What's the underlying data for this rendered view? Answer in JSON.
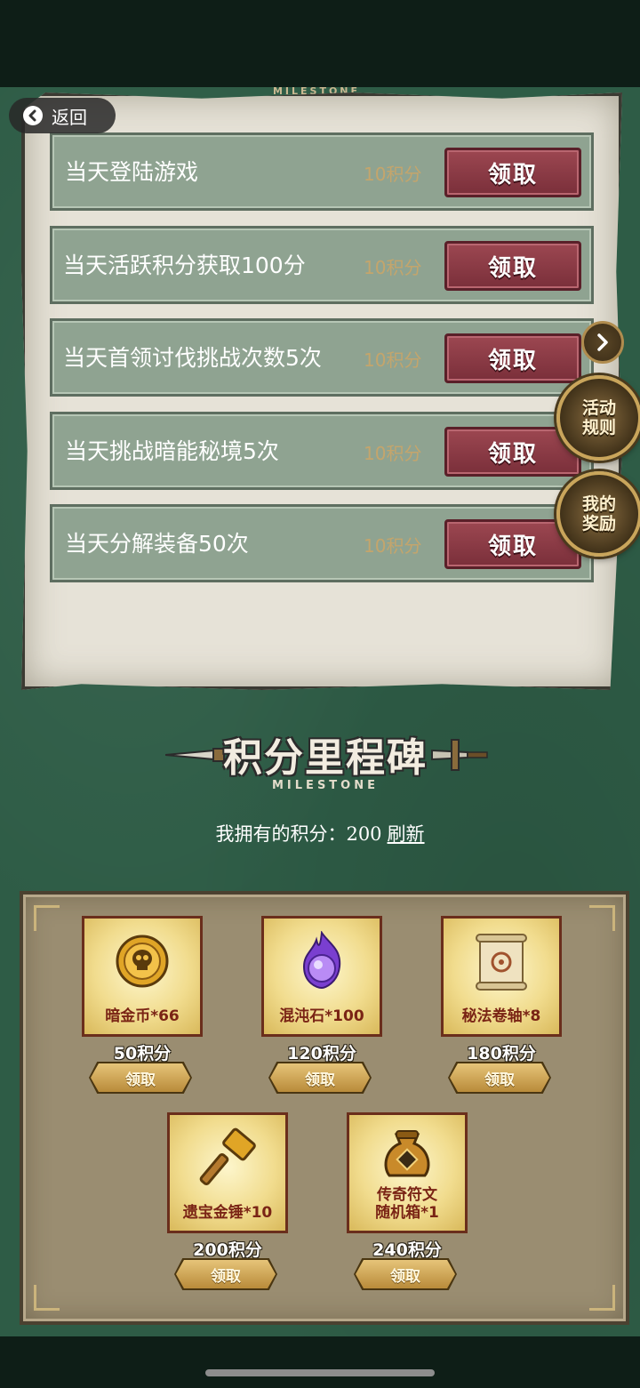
{
  "nav": {
    "back_label": "返回"
  },
  "header": {
    "milestone_en": "MILESTONE"
  },
  "tasks": [
    {
      "name": "当天登陆游戏",
      "points": "10积分",
      "button": "领取"
    },
    {
      "name": "当天活跃积分获取100分",
      "points": "10积分",
      "button": "领取"
    },
    {
      "name": "当天首领讨伐挑战次数5次",
      "points": "10积分",
      "button": "领取"
    },
    {
      "name": "当天挑战暗能秘境5次",
      "points": "10积分",
      "button": "领取"
    },
    {
      "name": "当天分解装备50次",
      "points": "10积分",
      "button": "领取"
    }
  ],
  "side": {
    "arrow_icon": "chevron-right-icon",
    "rules_label": "活动\n规则",
    "rewards_label": "我的\n奖励"
  },
  "milestone": {
    "title": "积分里程碑",
    "subtitle": "MILESTONE",
    "owned_label": "我拥有的积分：",
    "owned_value": "200",
    "refresh_label": "刷新"
  },
  "rewards": [
    {
      "name": "暗金币*66",
      "price": "50积分",
      "button": "领取",
      "icon": "skull-coin-icon"
    },
    {
      "name": "混沌石*100",
      "price": "120积分",
      "button": "领取",
      "icon": "purple-flame-orb-icon"
    },
    {
      "name": "秘法卷轴*8",
      "price": "180积分",
      "button": "领取",
      "icon": "scroll-icon"
    },
    {
      "name": "遗宝金锤*10",
      "price": "200积分",
      "button": "领取",
      "icon": "hammer-icon"
    },
    {
      "name": "传奇符文\n随机箱*1",
      "price": "240积分",
      "button": "领取",
      "icon": "rune-bag-icon"
    }
  ],
  "colors": {
    "background": "#2e5c46",
    "task_row": "#8fa391",
    "claim_red": "#8a3a45",
    "points_gold": "#c4a56c",
    "reward_panel": "#9a8d71"
  }
}
